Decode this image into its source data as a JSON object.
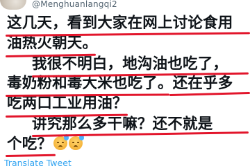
{
  "author": {
    "handle": "@Menghuanlangqi2"
  },
  "tweet": {
    "lines": [
      "这几天，看到大家在网上讨论食用",
      "油热火朝天。",
      "我很不明白，地沟油也吃了，",
      "毒奶粉和毒大米也吃了。还在乎多",
      "吃两口工业用油？",
      "讲究那么多干嘛？还不就是",
      "个吃？"
    ]
  },
  "translate_link": "Translate Tweet",
  "colors": {
    "underline": "#e2152b",
    "link": "#1d9bf0",
    "handle": "#536471"
  }
}
